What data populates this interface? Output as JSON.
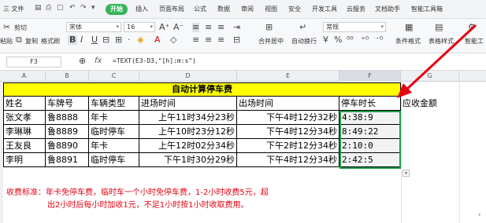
{
  "menu": {
    "file": "三 文件",
    "start": "开始",
    "items": [
      "插入",
      "页面布局",
      "公式",
      "数据",
      "审阅",
      "视图",
      "安全",
      "开发工具",
      "云服务",
      "文档助手",
      "智能工具箱"
    ]
  },
  "ribbon": {
    "cut": "剪切",
    "paste": "粘贴",
    "copy": "复制",
    "format_painter": "格式刷",
    "font_name": "宋体",
    "font_size": "16",
    "number_format": "常规",
    "merge_center": "合并居中",
    "wrap": "自动换行",
    "cond_format": "条件格式",
    "table_style": "表格样式",
    "smart": "智能工"
  },
  "formula_bar": {
    "cell_ref": "F3",
    "fx": "fx",
    "formula": "=TEXT(E3-D3,\"[h]:m:s\")"
  },
  "columns": [
    "A",
    "B",
    "C",
    "D",
    "E",
    "F",
    "G"
  ],
  "sheet": {
    "title": "自动计算停车费",
    "headers": [
      "姓名",
      "车牌号",
      "车辆类型",
      "进场时间",
      "出场时间",
      "停车时长",
      "应收金额"
    ],
    "rows": [
      [
        "张文孝",
        "鲁8888",
        "年卡",
        "上午11时34分23秒",
        "下午4时12分32秒",
        "4:38:9",
        ""
      ],
      [
        "李琳琳",
        "鲁8889",
        "临时停车",
        "上午10时23分12秒",
        "下午4时12分34秒",
        "8:49:22",
        ""
      ],
      [
        "王友良",
        "鲁8890",
        "年卡",
        "上午12时02分34秒",
        "下午2时12分34秒",
        "2:10:0",
        ""
      ],
      [
        "李明",
        "鲁8891",
        "临时停车",
        "下午1时30分29秒",
        "下午4时12分34秒",
        "2:42:5",
        ""
      ]
    ]
  },
  "note": {
    "line1": "收费标准：年卡免停车费，临时车一个小时免停车费，1-2小时收费5元，超",
    "line2": "出2小时后每小时加收1元，不足1小时按1小时收取费用。"
  },
  "colors": {
    "accent_green": "#35b558",
    "title_fill": "#ffff00",
    "note_red": "#e60012",
    "arrow_red": "#e60012"
  }
}
